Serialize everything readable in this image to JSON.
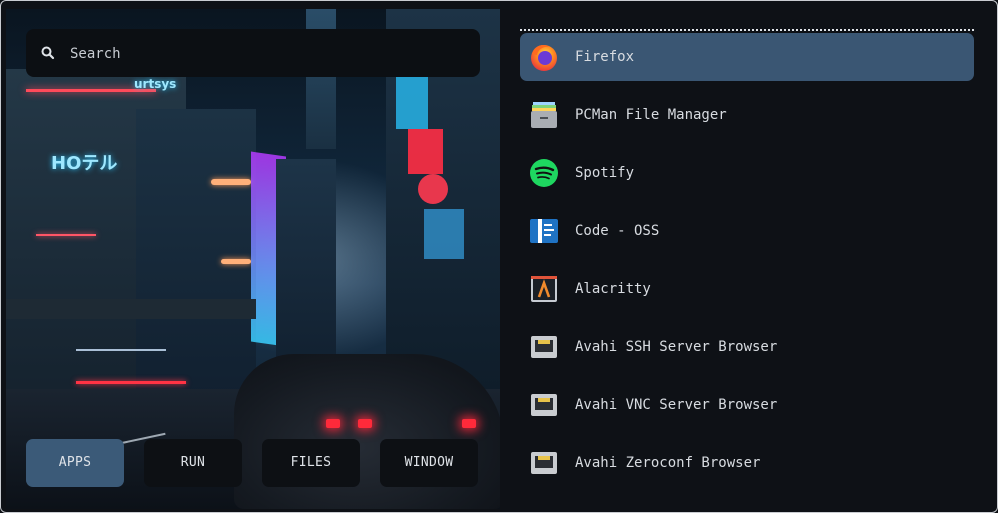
{
  "search": {
    "placeholder": "Search",
    "value": ""
  },
  "modes": [
    {
      "label": "APPS",
      "active": true
    },
    {
      "label": "RUN",
      "active": false
    },
    {
      "label": "FILES",
      "active": false
    },
    {
      "label": "WINDOW",
      "active": false
    }
  ],
  "apps": [
    {
      "name": "Firefox",
      "icon": "firefox-icon",
      "selected": true
    },
    {
      "name": "PCMan File Manager",
      "icon": "file-manager-icon",
      "selected": false
    },
    {
      "name": "Spotify",
      "icon": "spotify-icon",
      "selected": false
    },
    {
      "name": "Code - OSS",
      "icon": "code-oss-icon",
      "selected": false
    },
    {
      "name": "Alacritty",
      "icon": "alacritty-icon",
      "selected": false
    },
    {
      "name": "Avahi SSH Server Browser",
      "icon": "network-icon",
      "selected": false
    },
    {
      "name": "Avahi VNC Server Browser",
      "icon": "network-icon",
      "selected": false
    },
    {
      "name": "Avahi Zeroconf Browser",
      "icon": "network-icon",
      "selected": false
    }
  ],
  "colors": {
    "accent": "#3b5a78",
    "background": "#0e1116",
    "text": "#d8dce1"
  }
}
